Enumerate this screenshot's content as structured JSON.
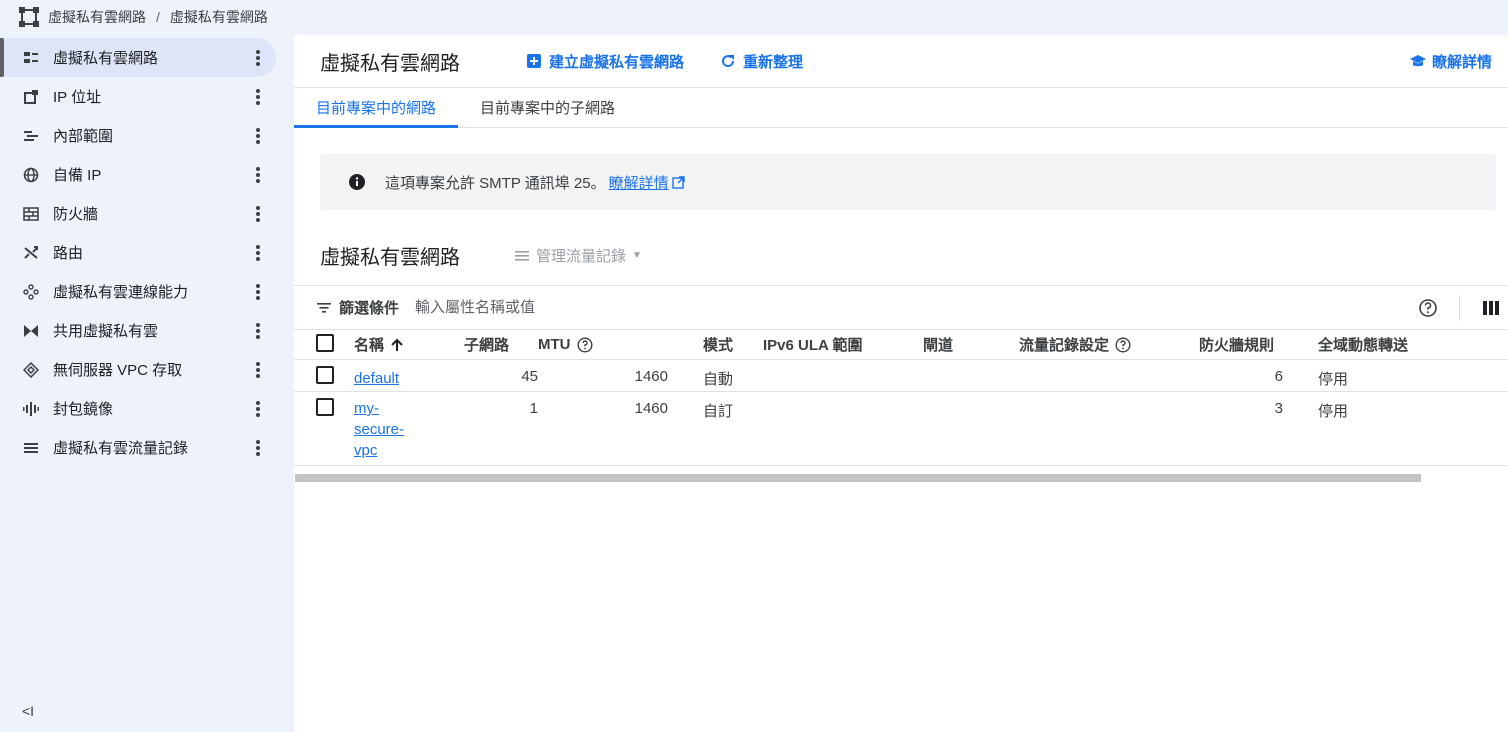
{
  "breadcrumb": {
    "items": [
      "虛擬私有雲網路",
      "虛擬私有雲網路"
    ],
    "separator": "/"
  },
  "sidebar": {
    "items": [
      {
        "label": "虛擬私有雲網路",
        "icon": "vpc-network-icon",
        "active": true
      },
      {
        "label": "IP 位址",
        "icon": "ip-address-icon"
      },
      {
        "label": "內部範圍",
        "icon": "internal-ranges-icon"
      },
      {
        "label": "自備 IP",
        "icon": "globe-icon"
      },
      {
        "label": "防火牆",
        "icon": "firewall-icon"
      },
      {
        "label": "路由",
        "icon": "routes-icon"
      },
      {
        "label": "虛擬私有雲連線能力",
        "icon": "connectivity-icon"
      },
      {
        "label": "共用虛擬私有雲",
        "icon": "shared-vpc-icon"
      },
      {
        "label": "無伺服器 VPC 存取",
        "icon": "serverless-icon"
      },
      {
        "label": "封包鏡像",
        "icon": "packet-mirroring-icon"
      },
      {
        "label": "虛擬私有雲流量記錄",
        "icon": "flow-logs-icon"
      }
    ],
    "collapse_label": "<I"
  },
  "toolbar": {
    "title": "虛擬私有雲網路",
    "create_label": "建立虛擬私有雲網路",
    "refresh_label": "重新整理",
    "learn_label": "瞭解詳情"
  },
  "tabs": [
    {
      "label": "目前專案中的網路",
      "active": true
    },
    {
      "label": "目前專案中的子網路",
      "active": false
    }
  ],
  "banner": {
    "text": "這項專案允許 SMTP 通訊埠 25。",
    "link": "瞭解詳情"
  },
  "section": {
    "title": "虛擬私有雲網路",
    "manage_label": "管理流量記錄"
  },
  "filter": {
    "label": "篩選條件",
    "placeholder": "輸入屬性名稱或值"
  },
  "table": {
    "columns": [
      "名稱",
      "子網路",
      "MTU",
      "模式",
      "IPv6 ULA 範圍",
      "閘道",
      "流量記錄設定",
      "防火牆規則",
      "全域動態轉送"
    ],
    "rows": [
      {
        "name": "default",
        "subnets": "45",
        "mtu": "1460",
        "mode": "自動",
        "ipv6": "",
        "gateway": "",
        "flowlogs": "",
        "firewall": "6",
        "routing": "停用"
      },
      {
        "name": "my-secure-vpc",
        "name_lines": [
          "my-",
          "secure-",
          "vpc"
        ],
        "subnets": "1",
        "mtu": "1460",
        "mode": "自訂",
        "ipv6": "",
        "gateway": "",
        "flowlogs": "",
        "firewall": "3",
        "routing": "停用"
      }
    ]
  },
  "colors": {
    "accent": "#1a73e8",
    "sidebar_bg": "#eef2fb",
    "active_item_bg": "#dde6f8"
  }
}
